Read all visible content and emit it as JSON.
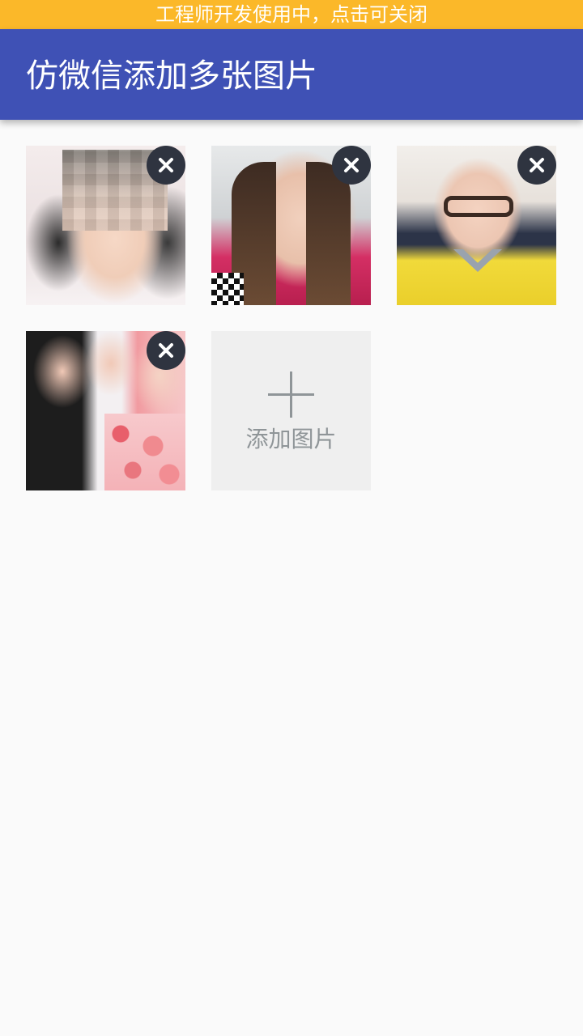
{
  "dev_banner": {
    "text": "工程师开发使用中，点击可关闭"
  },
  "app_bar": {
    "title": "仿微信添加多张图片"
  },
  "photos": [
    {
      "alt": "photo 1",
      "remove_icon": "close-icon"
    },
    {
      "alt": "photo 2",
      "remove_icon": "close-icon"
    },
    {
      "alt": "photo 3",
      "remove_icon": "close-icon"
    },
    {
      "alt": "photo 4",
      "remove_icon": "close-icon"
    }
  ],
  "add_tile": {
    "label": "添加图片",
    "icon": "plus-icon"
  },
  "colors": {
    "banner": "#fbb829",
    "app_bar": "#3f51b5",
    "background": "#fafafa",
    "remove_button": "#2f3440",
    "add_tile": "#efefef",
    "add_label": "#8f9598"
  }
}
